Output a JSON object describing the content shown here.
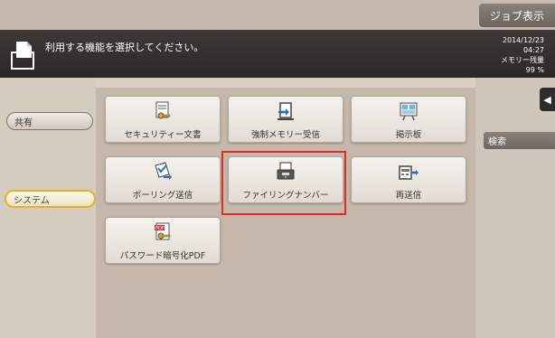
{
  "top": {
    "job_label": "ジョブ表示"
  },
  "header": {
    "message": "利用する機能を選択してください。",
    "date": "2014/12/23",
    "time": "04:27",
    "memory_label": "メモリー残量",
    "memory_value": "99 %"
  },
  "tabs": [
    {
      "label": "共有"
    },
    {
      "label": "システム",
      "selected": true
    }
  ],
  "functions": [
    {
      "label": "セキュリティー文書",
      "icon": "secure-document-icon"
    },
    {
      "label": "強制メモリー受信",
      "icon": "memory-receive-icon"
    },
    {
      "label": "掲示板",
      "icon": "bulletin-board-icon"
    },
    {
      "label": "ポーリング送信",
      "icon": "polling-transmit-icon"
    },
    {
      "label": "ファイリングナンバー",
      "icon": "filing-number-icon",
      "highlighted": true
    },
    {
      "label": "再送信",
      "icon": "resend-icon"
    },
    {
      "label": "パスワード暗号化PDF",
      "icon": "pdf-password-icon"
    }
  ],
  "right": {
    "search_label": "検索"
  },
  "colors": {
    "highlight": "#e02a2a",
    "selected_tab": "#e4b12c",
    "background": "#d9cfc3"
  }
}
